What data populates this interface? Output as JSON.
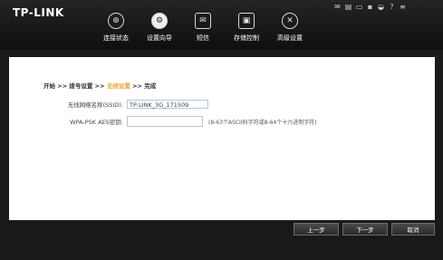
{
  "header": {
    "logo": "TP-LINK",
    "status_icons": [
      "mail-icon",
      "sms-icon",
      "battery-icon",
      "sim-icon",
      "wifi-icon",
      "help-icon",
      "menu-icon"
    ]
  },
  "nav": {
    "items": [
      {
        "label": "连接状态",
        "icon": "network-icon"
      },
      {
        "label": "设置向导",
        "icon": "gear-icon"
      },
      {
        "label": "短信",
        "icon": "mail-icon"
      },
      {
        "label": "存储控制",
        "icon": "storage-icon"
      },
      {
        "label": "高级设置",
        "icon": "tools-icon"
      }
    ]
  },
  "wizard": {
    "steps": [
      {
        "label": "开始"
      },
      {
        "label": "拨号设置"
      },
      {
        "label": "无线设置"
      },
      {
        "label": "完成"
      }
    ],
    "separator": " >> ",
    "current_step": 2
  },
  "form": {
    "ssid_label": "无线网络名称(SSID):",
    "ssid_value": "TP-LINK_3G_171509",
    "wpa_label": "WPA-PSK AES密钥:",
    "wpa_value": "",
    "wpa_hint": "(8-63个ASCII码字符或8-64个十六进制字符)"
  },
  "buttons": {
    "prev_label": "上一步",
    "next_label": "下一步",
    "cancel_label": "取消"
  },
  "colors": {
    "accent": "#e8a33a",
    "header_bg": "#141414",
    "content_bg": "#ffffff"
  }
}
